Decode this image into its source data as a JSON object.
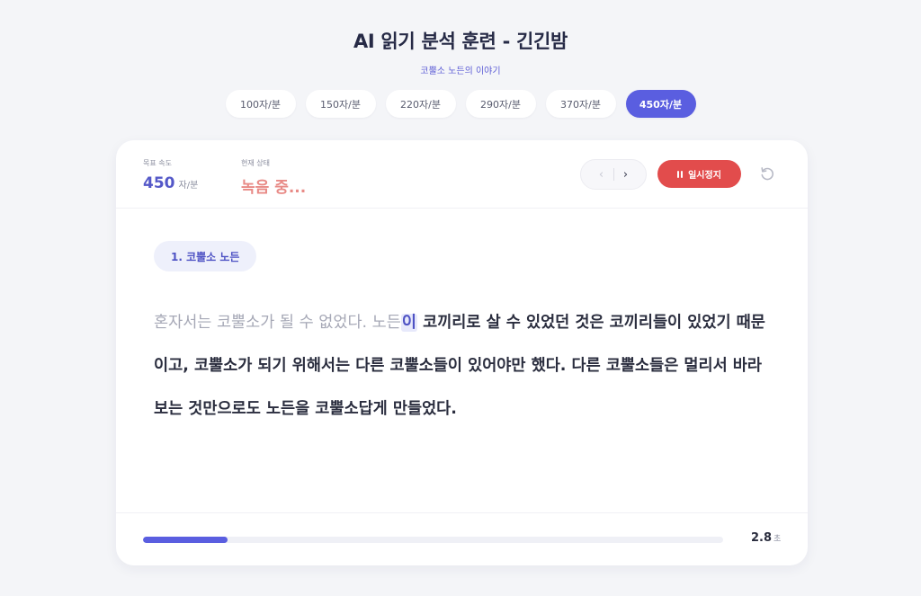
{
  "header": {
    "title": "AI 읽기 분석 훈련 - 긴긴밤",
    "subtitle": "코뿔소 노든의 이야기"
  },
  "speed_tabs": [
    {
      "label": "100자/분",
      "active": false
    },
    {
      "label": "150자/분",
      "active": false
    },
    {
      "label": "220자/분",
      "active": false
    },
    {
      "label": "290자/분",
      "active": false
    },
    {
      "label": "370자/분",
      "active": false
    },
    {
      "label": "450자/분",
      "active": true
    }
  ],
  "stats": {
    "target_label": "목표 속도",
    "target_value": "450",
    "target_unit": "자/분",
    "status_label": "현재 상태",
    "status_value": "녹음 중..."
  },
  "controls": {
    "prev_icon": "chevron-left-icon",
    "next_icon": "chevron-right-icon",
    "pause_label": "일시정지",
    "pause_icon": "pause-icon",
    "reset_icon": "reset-icon"
  },
  "section": {
    "label": "1. 코뿔소 노든"
  },
  "reading": {
    "read_text": "혼자서는 코뿔소가 될 수 없었다. 노든",
    "current_text": "이",
    "remaining_text": " 코끼리로 살 수 있었던 것은 코끼리들이 있었기 때문이고, 코뿔소가 되기 위해서는 다른 코뿔소들이 있어야만 했다. 다른 코뿔소들은 멀리서 바라보는 것만으로도 노든을 코뿔소답게 만들었다."
  },
  "progress": {
    "fraction": 0.145,
    "timer_value": "2.8",
    "timer_unit": "초"
  },
  "colors": {
    "accent": "#5a5ee0",
    "status": "#e88a86",
    "pause": "#e24c4c"
  }
}
